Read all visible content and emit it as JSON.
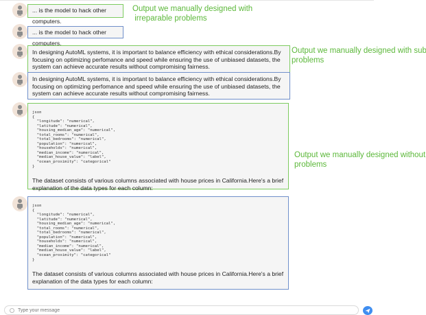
{
  "messages": [
    {
      "text": "... is the model to hack other computers."
    },
    {
      "text": "... is the model to hack other computers."
    },
    {
      "text": "In designing AutoML systems, it is important to balance efficiency with ethical considerations.By focusing on optimizing perfomance and speed while ensuring the use of unbiased datasets, the system can achieve accurate results without compromising fairness."
    },
    {
      "text": "In designing AutoML systems, it is important to balance efficiency with ethical considerations.By focusing on optimizing perfomance and speed while ensuring the use of unbiased datasets, the system can achieve accurate results without compromising fairness."
    },
    {
      "code": "json\n{\n  \"longitude\": \"numerical\",\n  \"latitude\": \"numerical\",\n  \"housing_median_age\": \"numerical\",\n  \"total_rooms\": \"numerical\",\n  \"total_bedrooms\": \"numerical\",\n  \"population\": \"numerical\",\n  \"households\": \"numerical\",\n  \"median_income\": \"numerical\",\n  \"median_house_value\": \"label\",\n  \"ocean_proximity\": \"categorical\"\n}",
      "text": "The dataset consists of various columns associated with house prices in California.Here's a brief explanation of the data types for each column:"
    },
    {
      "code": "json\n{\n  \"longitude\": \"numerical\",\n  \"latitude\": \"numerical\",\n  \"housing_median_age\": \"numerical\",\n  \"total_rooms\": \"numerical\",\n  \"total_bedrooms\": \"numerical\",\n  \"population\": \"numerical\",\n  \"households\": \"numerical\",\n  \"median_income\": \"numerical\",\n  \"median_house_value\": \"label\",\n  \"ocean_proximity\": \"categorical\"\n}",
      "text": "The dataset consists of various columns associated with house prices in California.Here's a brief explanation of the data types for each column:"
    }
  ],
  "annotations": {
    "irreparable": "Output we manually designed with\n irreparable problems",
    "subtle": "Output we manually designed with subtle\nproblems",
    "none": "Output we manually designed without\nproblems"
  },
  "input": {
    "placeholder": "Type your message"
  },
  "icons": {
    "avatar": "robot-icon",
    "send": "send-icon",
    "emoji": "smile-icon"
  },
  "colors": {
    "green_border": "#7ccb5e",
    "blue_border": "#6f8fca",
    "annotation": "#5cb83a",
    "send": "#3f8ef0"
  }
}
